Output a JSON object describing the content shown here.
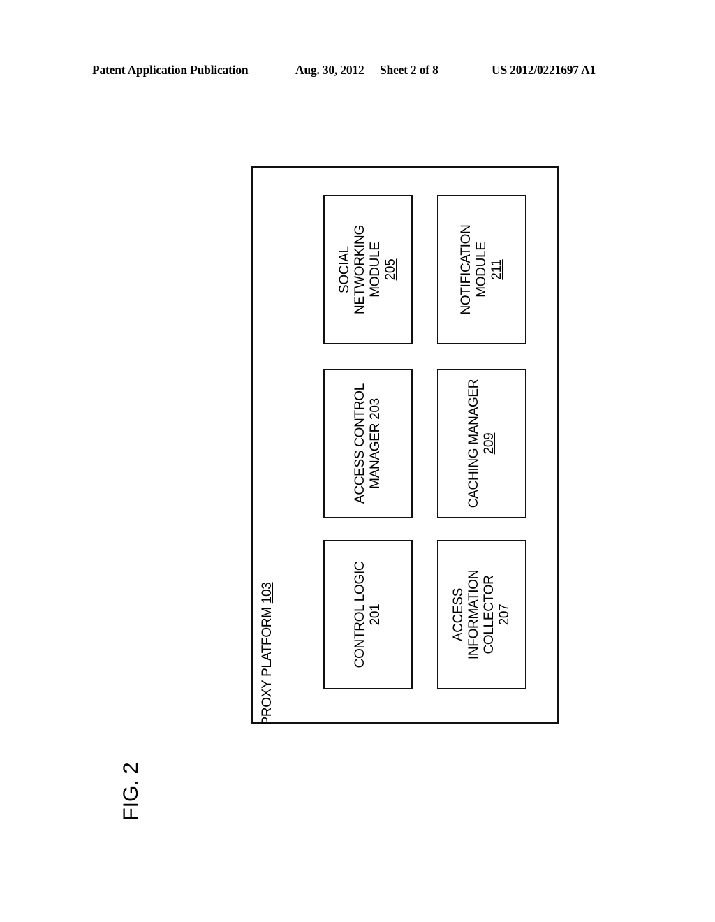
{
  "header": {
    "publication_type": "Patent Application Publication",
    "date": "Aug. 30, 2012",
    "sheet": "Sheet 2 of 8",
    "publication_number": "US 2012/0221697 A1"
  },
  "figure": {
    "label": "FIG. 2",
    "container": {
      "name": "PROXY PLATFORM",
      "ref": "103"
    },
    "modules": [
      {
        "id": "social-networking-module",
        "lines": [
          "SOCIAL",
          "NETWORKING",
          "MODULE"
        ],
        "ref": "205",
        "ref_inline": false
      },
      {
        "id": "notification-module",
        "lines": [
          "NOTIFICATION",
          "MODULE"
        ],
        "ref": "211",
        "ref_inline": false
      },
      {
        "id": "access-control-manager",
        "lines": [
          "ACCESS CONTROL",
          "MANAGER"
        ],
        "ref": "203",
        "ref_inline": true
      },
      {
        "id": "caching-manager",
        "lines": [
          "CACHING MANAGER"
        ],
        "ref": "209",
        "ref_inline": false
      },
      {
        "id": "control-logic",
        "lines": [
          "CONTROL LOGIC"
        ],
        "ref": "201",
        "ref_inline": false
      },
      {
        "id": "access-information-collector",
        "lines": [
          "ACCESS",
          "INFORMATION",
          "COLLECTOR"
        ],
        "ref": "207",
        "ref_inline": false
      }
    ]
  }
}
